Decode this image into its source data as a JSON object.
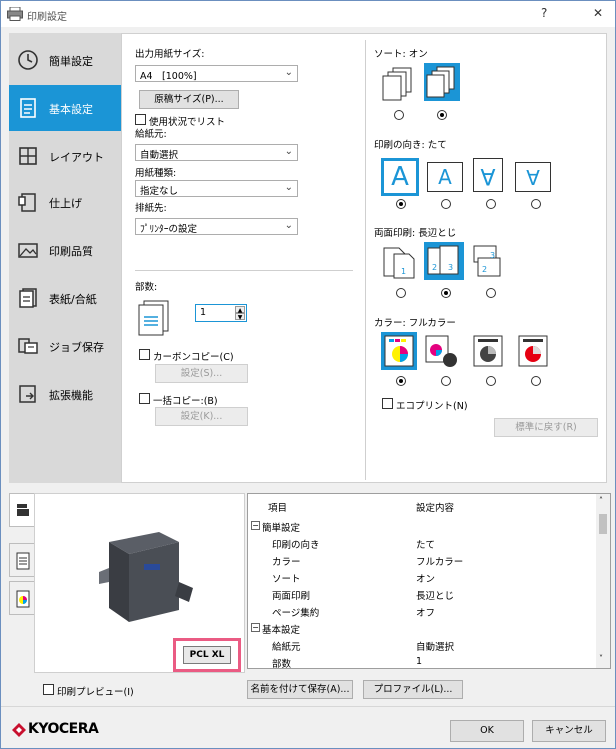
{
  "window": {
    "title": "印刷設定",
    "help": "?",
    "close": "✕"
  },
  "nav": {
    "items": [
      {
        "label": "簡単設定",
        "icon": "clock-icon"
      },
      {
        "label": "基本設定",
        "icon": "document-icon"
      },
      {
        "label": "レイアウト",
        "icon": "layout-grid-icon"
      },
      {
        "label": "仕上げ",
        "icon": "finishing-icon"
      },
      {
        "label": "印刷品質",
        "icon": "image-quality-icon"
      },
      {
        "label": "表紙/合紙",
        "icon": "cover-page-icon"
      },
      {
        "label": "ジョブ保存",
        "icon": "job-storage-icon"
      },
      {
        "label": "拡張機能",
        "icon": "extension-icon"
      }
    ],
    "active_index": 1
  },
  "basic": {
    "paper_size_label": "出力用紙サイズ:",
    "paper_size_value": "A4　[100%]",
    "original_size_button": "原稿サイズ(P)...",
    "usage_list_label": "使用状況でリスト",
    "paper_source_label": "給紙元:",
    "paper_source_value": "自動選択",
    "paper_type_label": "用紙種類:",
    "paper_type_value": "指定なし",
    "output_label": "排紙先:",
    "output_value": "ﾌﾟﾘﾝﾀｰの設定",
    "copies_label": "部数:",
    "copies_value": "1",
    "carbon_copy_label": "カーボンコピー(C)",
    "carbon_settings_button": "設定(S)...",
    "batch_copy_label": "一括コピー:(B)",
    "batch_settings_button": "設定(K)..."
  },
  "right": {
    "sort_label": "ソート:  オン",
    "orientation_label": "印刷の向き:  たて",
    "orientation_glyph": "A",
    "duplex_label": "両面印刷:  長辺とじ",
    "color_label": "カラー:  フルカラー",
    "ecoprint_label": "エコプリント(N)",
    "reset_button": "標準に戻す(R)"
  },
  "tree": {
    "header_item": "項目",
    "header_value": "設定内容",
    "rows": [
      {
        "item": "簡単設定",
        "value": "",
        "group": true
      },
      {
        "item": "印刷の向き",
        "value": "たて"
      },
      {
        "item": "カラー",
        "value": "フルカラー"
      },
      {
        "item": "ソート",
        "value": "オン"
      },
      {
        "item": "両面印刷",
        "value": "長辺とじ"
      },
      {
        "item": "ページ集約",
        "value": "オフ"
      },
      {
        "item": "基本設定",
        "value": "",
        "group": true
      },
      {
        "item": "給紙元",
        "value": "自動選択"
      },
      {
        "item": "部数",
        "value": "1"
      }
    ]
  },
  "preview": {
    "pcl_label": "PCL XL"
  },
  "bottom": {
    "print_preview_label": "印刷プレビュー(I)",
    "save_as_button": "名前を付けて保存(A)...",
    "profile_button": "プロファイル(L)...",
    "brand": "KYOCERA",
    "ok_button": "OK",
    "cancel_button": "キャンセル"
  },
  "colors": {
    "accent": "#1b95d6",
    "highlight": "#ea5b83",
    "brand": "#c8102e"
  }
}
